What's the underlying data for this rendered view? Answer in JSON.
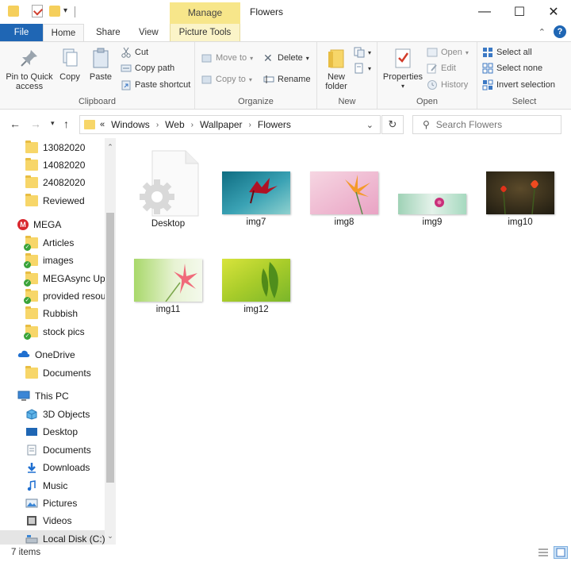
{
  "window": {
    "title": "Flowers",
    "context_tab": "Manage",
    "controls": {
      "minimize": "—",
      "maximize": "☐",
      "close": "✕"
    }
  },
  "tabs": [
    {
      "label": "File"
    },
    {
      "label": "Home"
    },
    {
      "label": "Share"
    },
    {
      "label": "View"
    },
    {
      "label": "Picture Tools"
    }
  ],
  "ribbon": {
    "clipboard": {
      "label": "Clipboard",
      "pin_label_1": "Pin to Quick",
      "pin_label_2": "access",
      "copy": "Copy",
      "paste": "Paste",
      "cut": "Cut",
      "copy_path": "Copy path",
      "paste_shortcut": "Paste shortcut"
    },
    "organize": {
      "label": "Organize",
      "move_to": "Move to",
      "copy_to": "Copy to",
      "delete": "Delete",
      "rename": "Rename"
    },
    "new": {
      "label": "New",
      "new_folder_1": "New",
      "new_folder_2": "folder"
    },
    "open": {
      "label": "Open",
      "properties": "Properties",
      "open": "Open",
      "edit": "Edit",
      "history": "History"
    },
    "select": {
      "label": "Select",
      "select_all": "Select all",
      "select_none": "Select none",
      "invert_selection": "Invert selection"
    }
  },
  "address": {
    "prefix": "«",
    "crumbs": [
      "Windows",
      "Web",
      "Wallpaper",
      "Flowers"
    ],
    "search_placeholder": "Search Flowers"
  },
  "nav": {
    "items": [
      {
        "label": "13082020",
        "icon": "folder-icon"
      },
      {
        "label": "14082020",
        "icon": "folder-icon"
      },
      {
        "label": "24082020",
        "icon": "folder-icon"
      },
      {
        "label": "Reviewed",
        "icon": "folder-icon"
      },
      {
        "label": "MEGA",
        "icon": "mega-icon"
      },
      {
        "label": "Articles",
        "icon": "synced-folder-icon"
      },
      {
        "label": "images",
        "icon": "synced-folder-icon"
      },
      {
        "label": "MEGAsync Uplo",
        "icon": "synced-folder-icon"
      },
      {
        "label": "provided resourc",
        "icon": "synced-folder-icon"
      },
      {
        "label": "Rubbish",
        "icon": "folder-icon"
      },
      {
        "label": "stock pics",
        "icon": "synced-folder-icon"
      },
      {
        "label": "OneDrive",
        "icon": "onedrive-icon"
      },
      {
        "label": "Documents",
        "icon": "folder-icon"
      },
      {
        "label": "This PC",
        "icon": "computer-icon"
      },
      {
        "label": "3D Objects",
        "icon": "3d-objects-icon"
      },
      {
        "label": "Desktop",
        "icon": "desktop-icon"
      },
      {
        "label": "Documents",
        "icon": "documents-icon"
      },
      {
        "label": "Downloads",
        "icon": "downloads-icon"
      },
      {
        "label": "Music",
        "icon": "music-icon"
      },
      {
        "label": "Pictures",
        "icon": "pictures-icon"
      },
      {
        "label": "Videos",
        "icon": "videos-icon"
      },
      {
        "label": "Local Disk (C:)",
        "icon": "local-disk-icon"
      }
    ]
  },
  "files": [
    {
      "name": "Desktop",
      "kind": "settings-file"
    },
    {
      "name": "img7",
      "kind": "image"
    },
    {
      "name": "img8",
      "kind": "image"
    },
    {
      "name": "img9",
      "kind": "image"
    },
    {
      "name": "img10",
      "kind": "image"
    },
    {
      "name": "img11",
      "kind": "image"
    },
    {
      "name": "img12",
      "kind": "image"
    }
  ],
  "status": {
    "item_count": "7 items"
  }
}
